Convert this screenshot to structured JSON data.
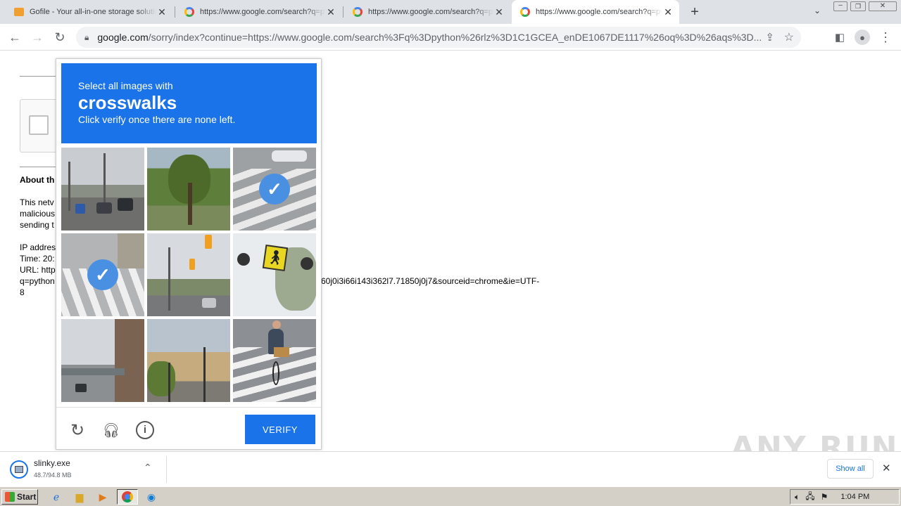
{
  "tabs": [
    {
      "title": "Gofile - Your all-in-one storage solution"
    },
    {
      "title": "https://www.google.com/search?q=python&rlz"
    },
    {
      "title": "https://www.google.com/search?q=python&rlz"
    },
    {
      "title": "https://www.google.com/search?q=python&rlz"
    }
  ],
  "toolbar": {
    "url_host": "google.com",
    "url_rest": "/sorry/index?continue=https://www.google.com/search%3Fq%3Dpython%26rlz%3D1C1GCEA_enDE1067DE1117%26oq%3D%26aqs%3D..."
  },
  "page": {
    "about_heading": "About th",
    "p1": "This netv",
    "p2": "malicious",
    "p3": "sending t",
    "ip": "IP addres",
    "time": "Time: 20:",
    "url": "URL: http",
    "q": "q=python",
    "url_tail": "60j0i3i66i143i362l7.71850j0j7&sourceid=chrome&ie=UTF-",
    "eight": "8"
  },
  "captcha": {
    "instruction": "Select all images with",
    "keyword": "crosswalks",
    "hint": "Click verify once there are none left.",
    "verify_label": "VERIFY",
    "tiles": [
      {
        "scene": "traffic-road",
        "selected": false
      },
      {
        "scene": "trees",
        "selected": false
      },
      {
        "scene": "crosswalk",
        "selected": true
      },
      {
        "scene": "crosswalk",
        "selected": true
      },
      {
        "scene": "traffic-lights",
        "selected": false
      },
      {
        "scene": "pedestrian-sign",
        "selected": false
      },
      {
        "scene": "overpass",
        "selected": false
      },
      {
        "scene": "buildings",
        "selected": false
      },
      {
        "scene": "cyclist-crosswalk",
        "selected": false
      }
    ]
  },
  "download": {
    "filename": "slinky.exe",
    "progress": "48.7/94.8 MB",
    "show_all": "Show all"
  },
  "watermark": "ANY RUN",
  "taskbar": {
    "start_label": "Start",
    "clock": "1:04 PM"
  },
  "colors": {
    "accent": "#1a73e8",
    "check": "#4a90e2"
  }
}
